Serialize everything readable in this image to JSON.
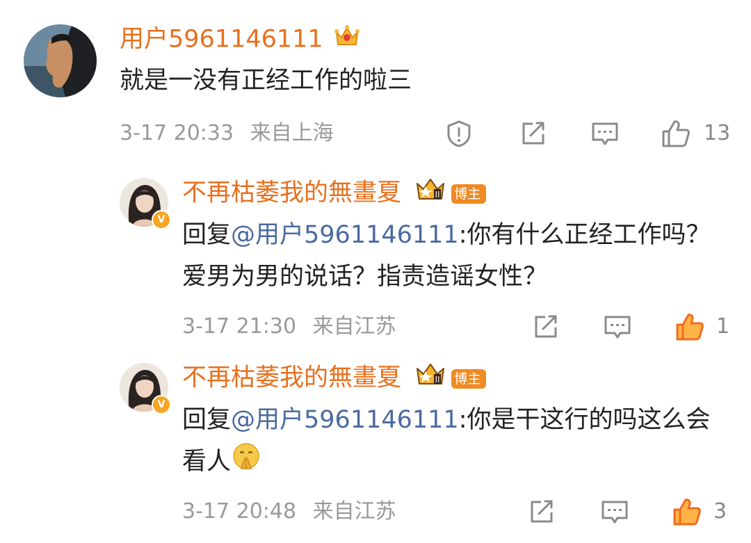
{
  "comment1": {
    "username": "用户5961146111",
    "text": "就是一没有正经工作的啦三",
    "time": "3-17 20:33",
    "location": "来自上海",
    "like_count": "13",
    "icons": [
      "report-icon",
      "share-icon",
      "comment-icon",
      "like-icon"
    ]
  },
  "reply1": {
    "username": "不再枯萎我的無畫夏",
    "badge": "博主",
    "prefix": "回复",
    "mention": "@用户5961146111",
    "text": ":你有什么正经工作吗？爱男为男的说话？指责造谣女性？",
    "time": "3-17 21:30",
    "location": "来自江苏",
    "like_count": "1"
  },
  "reply2": {
    "username": "不再枯萎我的無畫夏",
    "badge": "博主",
    "prefix": "回复",
    "mention": "@用户5961146111",
    "text": ":你是干这行的吗这么会看人",
    "time": "3-17 20:48",
    "location": "来自江苏",
    "like_count": "3"
  },
  "colors": {
    "username": "#e8701e",
    "mention": "#4a6aa0",
    "meta": "#999999",
    "liked": "#f26b1d",
    "badge": "#f08a22"
  }
}
